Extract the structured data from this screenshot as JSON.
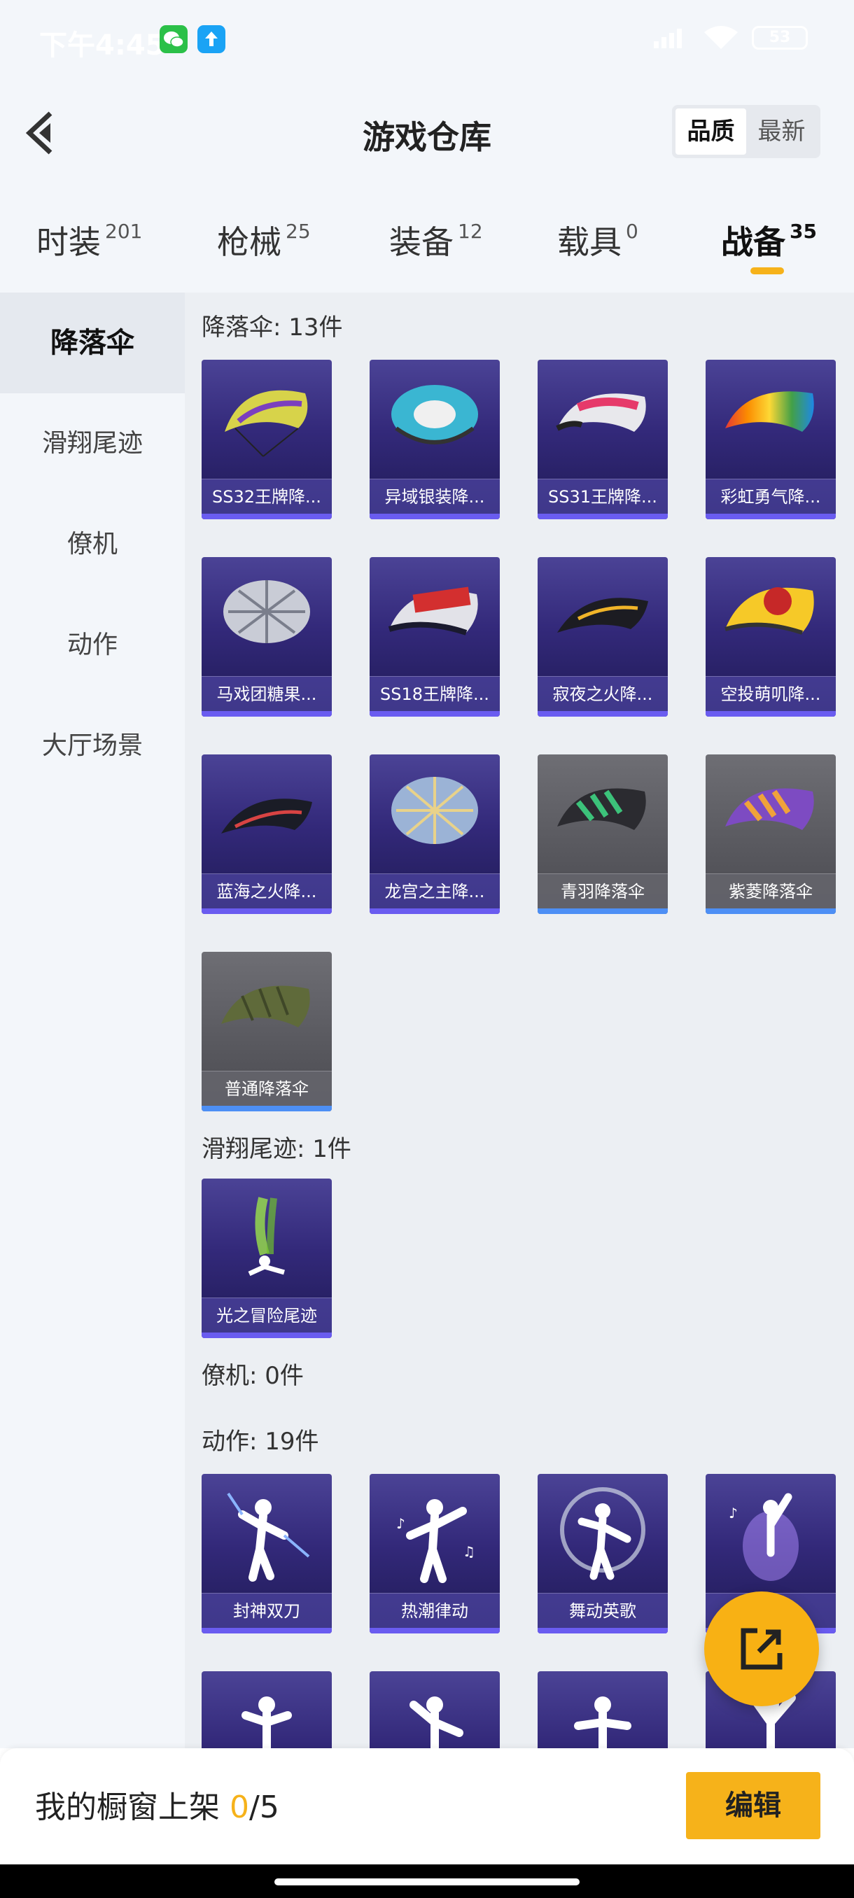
{
  "status_bar": {
    "time": "下午4:45",
    "battery": "53"
  },
  "header": {
    "title": "游戏仓库",
    "sort_options": [
      "品质",
      "最新"
    ]
  },
  "tabs": [
    {
      "label": "时装",
      "count": "201"
    },
    {
      "label": "枪械",
      "count": "25"
    },
    {
      "label": "装备",
      "count": "12"
    },
    {
      "label": "载具",
      "count": "0"
    },
    {
      "label": "战备",
      "count": "35"
    }
  ],
  "sidebar": [
    "降落伞",
    "滑翔尾迹",
    "僚机",
    "动作",
    "大厅场景"
  ],
  "sections": {
    "parachute": {
      "title": "降落伞: 13件",
      "items": [
        "SS32王牌降...",
        "异域银装降...",
        "SS31王牌降...",
        "彩虹勇气降...",
        "马戏团糖果...",
        "SS18王牌降...",
        "寂夜之火降...",
        "空投萌叽降...",
        "蓝海之火降...",
        "龙宫之主降...",
        "青羽降落伞",
        "紫菱降落伞",
        "普通降落伞"
      ]
    },
    "trail": {
      "title": "滑翔尾迹: 1件",
      "items": [
        "光之冒险尾迹"
      ]
    },
    "wingman": {
      "title": "僚机: 0件"
    },
    "emote": {
      "title": "动作: 19件",
      "items": [
        "封神双刀",
        "热潮律动",
        "舞动英歌",
        ""
      ]
    }
  },
  "bottom": {
    "shelf_label": "我的橱窗上架",
    "shelf_used": "0",
    "shelf_total": "/5",
    "edit_label": "编辑"
  },
  "colors": {
    "accent": "#f6b21a",
    "card_purple": "#33297a",
    "card_grey": "#5a5a60"
  }
}
